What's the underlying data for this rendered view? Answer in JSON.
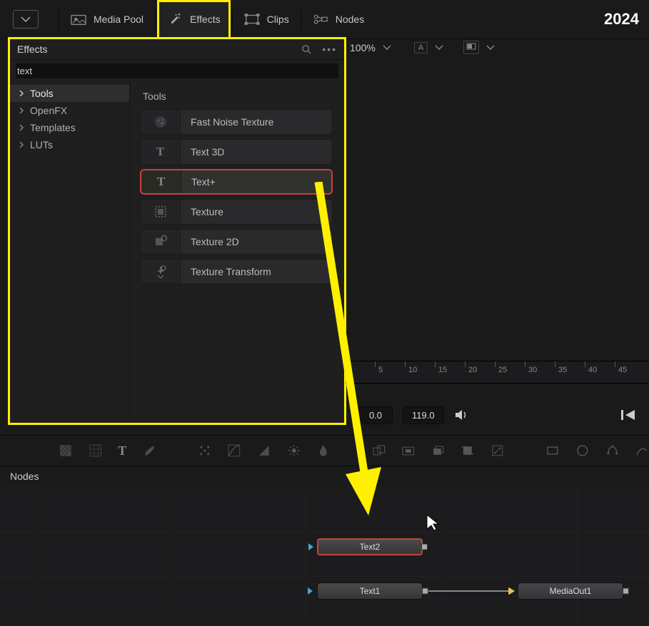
{
  "topbar": {
    "year": "2024",
    "tabs": {
      "mediapool": "Media Pool",
      "effects": "Effects",
      "clips": "Clips",
      "nodes": "Nodes"
    }
  },
  "effects": {
    "title": "Effects",
    "search": "text",
    "categories": [
      "Tools",
      "OpenFX",
      "Templates",
      "LUTs"
    ],
    "section": "Tools",
    "items": [
      "Fast Noise Texture",
      "Text 3D",
      "Text+",
      "Texture",
      "Texture 2D",
      "Texture Transform"
    ]
  },
  "viewer": {
    "zoom": "100%",
    "letterA": "A"
  },
  "ruler": {
    "ticks": [
      "5",
      "10",
      "15",
      "20",
      "25",
      "30",
      "35",
      "40",
      "45"
    ]
  },
  "transport": {
    "start": "0.0",
    "end": "119.0"
  },
  "nodes_header": "Nodes",
  "nodes": {
    "text2": "Text2",
    "text1": "Text1",
    "mediaout": "MediaOut1"
  }
}
